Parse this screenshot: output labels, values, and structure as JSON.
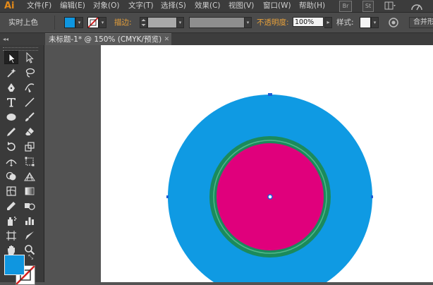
{
  "app": {
    "logo": "Ai",
    "menus": [
      "文件(F)",
      "编辑(E)",
      "对象(O)",
      "文字(T)",
      "选择(S)",
      "效果(C)",
      "视图(V)",
      "窗口(W)",
      "帮助(H)"
    ],
    "bridge_button": "Br",
    "stock_button": "St"
  },
  "control_bar": {
    "selection_label": "实时上色",
    "fill_color": "#0f96e0",
    "stroke_label": "描边",
    "opacity_label": "不透明度",
    "opacity_value": "100%",
    "style_label": "样式",
    "merge_button": "合并形"
  },
  "document": {
    "tab_title": "未标题-1* @ 150% (CMYK/预览)"
  },
  "tools": [
    "selection-tool",
    "direct-selection-tool",
    "magic-wand-tool",
    "lasso-tool",
    "pen-tool",
    "curvature-tool",
    "type-tool",
    "line-segment-tool",
    "ellipse-tool",
    "paintbrush-tool",
    "pencil-tool",
    "eraser-tool",
    "rotate-tool",
    "scale-tool",
    "width-tool",
    "free-transform-tool",
    "shape-builder-tool",
    "perspective-grid-tool",
    "mesh-tool",
    "gradient-tool",
    "eyedropper-tool",
    "blend-tool",
    "symbol-sprayer-tool",
    "column-graph-tool",
    "artboard-tool",
    "slice-tool",
    "hand-tool",
    "zoom-tool"
  ],
  "colors": {
    "outer_circle": "#0f9ae3",
    "ring": "#1b8a5c",
    "ring_inner_line": "#4fb98a",
    "inner_circle": "#e0007c",
    "accent_orange": "#e8a13a"
  }
}
